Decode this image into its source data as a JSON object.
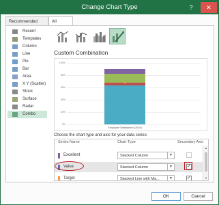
{
  "window": {
    "title": "Change Chart Type",
    "help_label": "?",
    "close_label": "✕"
  },
  "tabs": [
    {
      "label": "Recommended Charts",
      "active": false
    },
    {
      "label": "All Charts",
      "active": true
    }
  ],
  "nav_items": [
    {
      "label": "Recent",
      "icon": "recent-icon"
    },
    {
      "label": "Templates",
      "icon": "templates-icon"
    },
    {
      "label": "Column",
      "icon": "column-icon"
    },
    {
      "label": "Line",
      "icon": "line-icon"
    },
    {
      "label": "Pie",
      "icon": "pie-icon"
    },
    {
      "label": "Bar",
      "icon": "bar-icon"
    },
    {
      "label": "Area",
      "icon": "area-icon"
    },
    {
      "label": "X Y (Scatter)",
      "icon": "scatter-icon"
    },
    {
      "label": "Stock",
      "icon": "stock-icon"
    },
    {
      "label": "Surface",
      "icon": "surface-icon"
    },
    {
      "label": "Radar",
      "icon": "radar-icon"
    },
    {
      "label": "Combo",
      "icon": "combo-icon",
      "selected": true
    }
  ],
  "section_title": "Custom Combination",
  "preview": {
    "y_ticks": [
      "100%",
      "80%",
      "60%",
      "40%",
      "20%",
      "0%"
    ],
    "category": "Employee Satisfaction (2016)",
    "segments": [
      {
        "name": "Blue",
        "color": "#4bacc6",
        "percent": 63
      },
      {
        "name": "Red",
        "color": "#c0504d",
        "percent": 5
      },
      {
        "name": "Green",
        "color": "#9bbb59",
        "percent": 14
      },
      {
        "name": "Purple",
        "color": "#8064a2",
        "percent": 8
      }
    ]
  },
  "series_prompt": "Choose the chart type and axis for your data series:",
  "series_headers": {
    "name": "Series Name",
    "type": "Chart Type",
    "axis": "Secondary Axis"
  },
  "series": [
    {
      "name": "Excellent",
      "color": "#8064a2",
      "chart_type": "Stacked Column",
      "secondary_axis": false
    },
    {
      "name": "Value",
      "color": "#5b6dbb",
      "chart_type": "Stacked Column",
      "secondary_axis": true
    },
    {
      "name": "Target",
      "color": "#f79646",
      "chart_type": "Stacked Line with Ma...",
      "secondary_axis": true
    }
  ],
  "buttons": {
    "ok": "OK",
    "cancel": "Cancel"
  }
}
